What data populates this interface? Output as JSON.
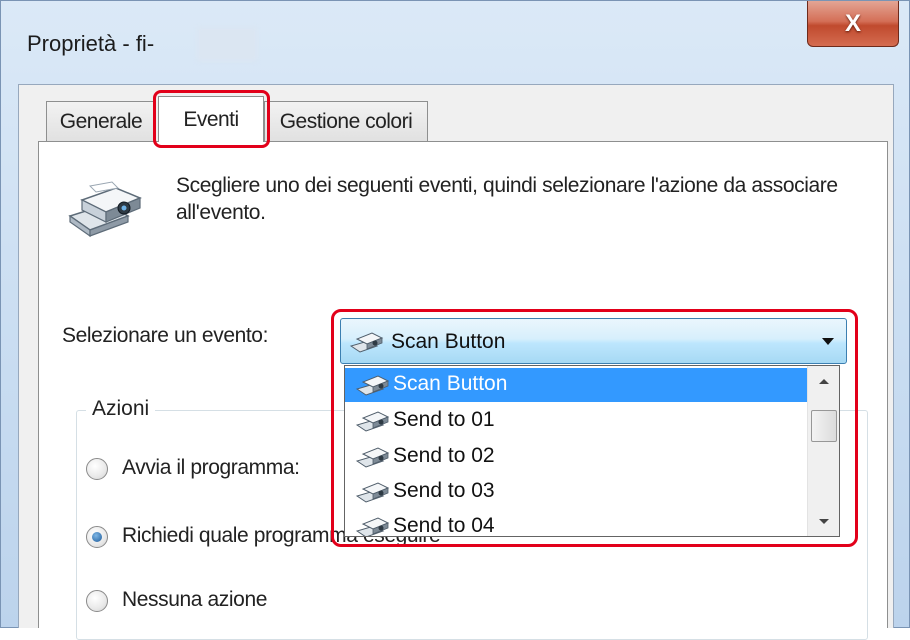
{
  "window": {
    "title": "Proprietà - fi-",
    "close_label": "X"
  },
  "tabs": [
    {
      "label": "Generale"
    },
    {
      "label": "Eventi"
    },
    {
      "label": "Gestione colori"
    }
  ],
  "events_panel": {
    "instruction": "Scegliere uno dei seguenti eventi, quindi selezionare l'azione da associare all'evento.",
    "select_label": "Selezionare un evento:",
    "selected_event": "Scan Button",
    "event_options": [
      "Scan Button",
      "Send to 01",
      "Send to 02",
      "Send to 03",
      "Send to 04"
    ]
  },
  "actions": {
    "group_label": "Azioni",
    "options": [
      {
        "label": "Avvia il programma:",
        "checked": false
      },
      {
        "label": "Richiedi quale programma eseguire",
        "checked": true
      },
      {
        "label": "Nessuna azione",
        "checked": false
      }
    ]
  },
  "colors": {
    "highlight": "#e2001a",
    "selection": "#3399ff",
    "close_button": "#c8563d"
  },
  "icons": {
    "event_icon": "scanner-icon"
  }
}
